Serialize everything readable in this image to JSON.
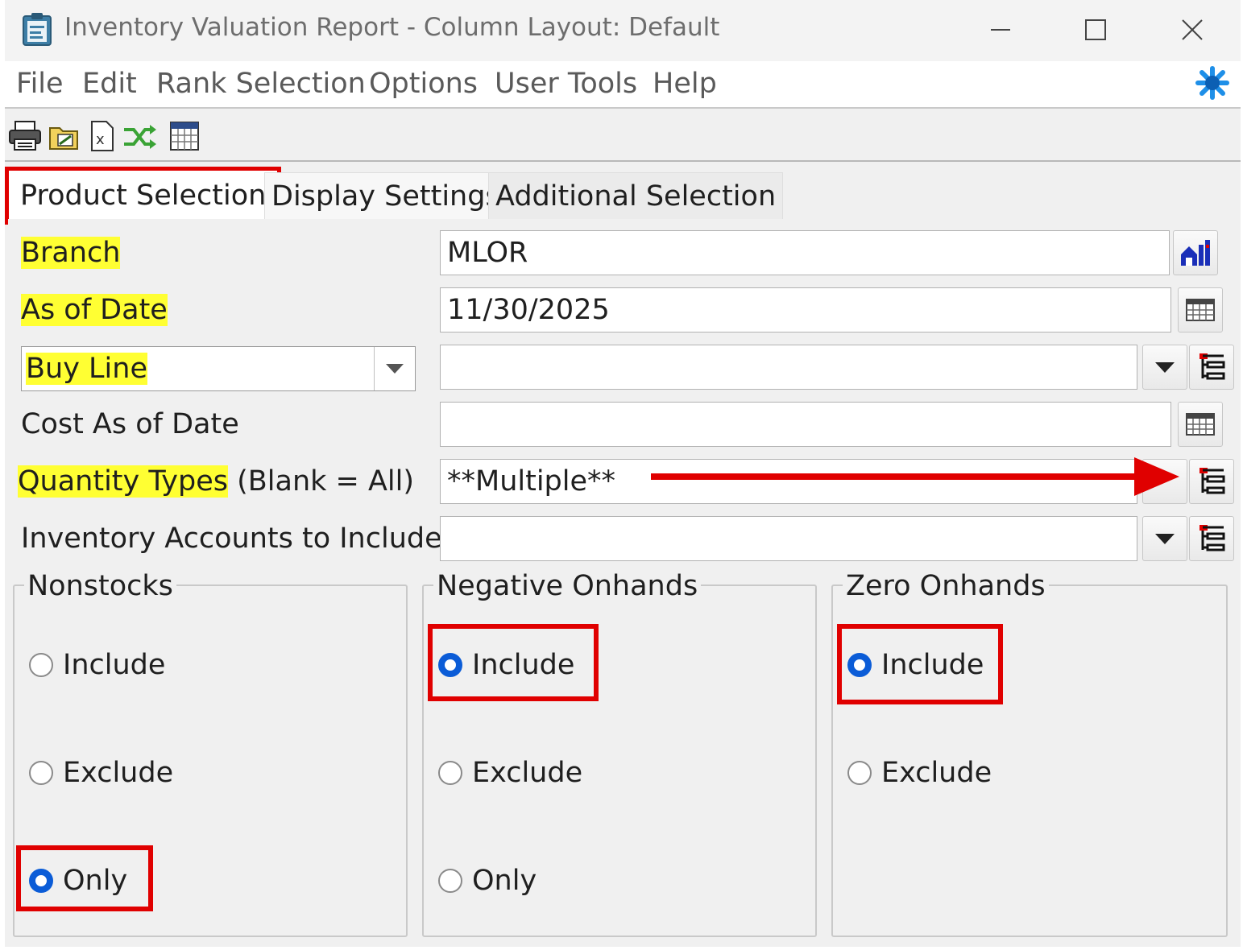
{
  "window": {
    "title": "Inventory Valuation Report - Column Layout: Default",
    "controls": {
      "minimize": "minimize-icon",
      "maximize": "maximize-icon",
      "close": "close-icon"
    }
  },
  "menu": {
    "items": [
      "File",
      "Edit",
      "Rank Selection",
      "Options",
      "User Tools",
      "Help"
    ]
  },
  "toolbar": {
    "icons": [
      "print-icon",
      "open-folder-icon",
      "excel-export-icon",
      "shuffle-icon",
      "calendar-grid-icon"
    ]
  },
  "tabs": [
    {
      "label": "Product Selection",
      "active": true
    },
    {
      "label": "Display Settings",
      "active": false
    },
    {
      "label": "Additional Selection",
      "active": false
    }
  ],
  "fields": {
    "branch": {
      "label": "Branch",
      "value": "MLOR"
    },
    "as_of_date": {
      "label": "As of Date",
      "value": "11/30/2025"
    },
    "buy_line": {
      "selector_value": "Buy Line",
      "value": ""
    },
    "cost_as_of_date": {
      "label": "Cost As of Date",
      "value": ""
    },
    "quantity_types": {
      "label_highlight": "Quantity Types",
      "label_rest": " (Blank = All)",
      "value": "**Multiple**"
    },
    "inventory_accounts": {
      "label": "Inventory Accounts to Include",
      "value": ""
    }
  },
  "groups": {
    "nonstocks": {
      "title": "Nonstocks",
      "options": [
        "Include",
        "Exclude",
        "Only"
      ],
      "selected": "Only"
    },
    "negative_onhands": {
      "title": "Negative Onhands",
      "options": [
        "Include",
        "Exclude",
        "Only"
      ],
      "selected": "Include"
    },
    "zero_onhands": {
      "title": "Zero Onhands",
      "options": [
        "Include",
        "Exclude"
      ],
      "selected": "Include"
    }
  },
  "colors": {
    "highlight": "#ffff33",
    "annotation_red": "#e00000",
    "radio_selected": "#0b5cd7",
    "lookup_icon": "#1a2fb8"
  }
}
